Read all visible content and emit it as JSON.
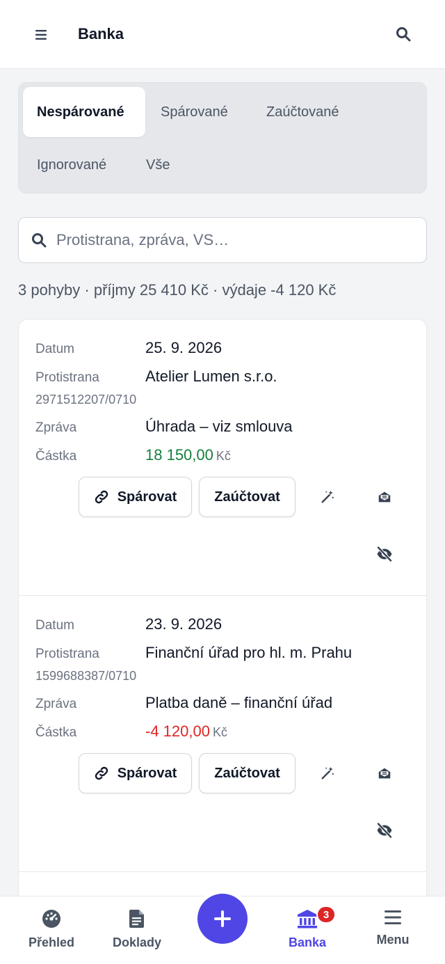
{
  "header": {
    "title": "Banka",
    "menu_icon": "hamburger-icon",
    "search_icon": "search-icon"
  },
  "tabs": [
    {
      "label": "Nespárované",
      "active": true
    },
    {
      "label": "Spárované",
      "active": false
    },
    {
      "label": "Zaúčtované",
      "active": false
    },
    {
      "label": "Ignorované",
      "active": false
    },
    {
      "label": "Vše",
      "active": false
    }
  ],
  "search": {
    "placeholder": "Protistrana, zpráva, VS…",
    "value": ""
  },
  "summary": "3 pohyby · příjmy 25 410 Kč · výdaje -4 120 Kč",
  "labels": {
    "date": "Datum",
    "counterparty": "Protistrana",
    "message": "Zpráva",
    "amount": "Částka"
  },
  "actions": {
    "match": "Spárovat",
    "post": "Zaúčtovat"
  },
  "transactions": [
    {
      "date": "25. 9. 2026",
      "counterparty": "Atelier Lumen s.r.o.",
      "account": "2971512207/0710",
      "message": "Úhrada – viz smlouva",
      "amount": "18 150,00",
      "currency": "Kč",
      "direction": "income"
    },
    {
      "date": "23. 9. 2026",
      "counterparty": "Finanční úřad pro hl. m. Prahu",
      "account": "1599688387/0710",
      "message": "Platba daně – finanční úřad",
      "amount": "-4 120,00",
      "currency": "Kč",
      "direction": "expense"
    }
  ],
  "bottom_nav": {
    "items": [
      {
        "label": "Přehled",
        "icon": "dashboard-icon"
      },
      {
        "label": "Doklady",
        "icon": "document-icon"
      },
      {
        "label": "Banka",
        "icon": "bank-icon",
        "active": true,
        "badge": "3"
      },
      {
        "label": "Menu",
        "icon": "hamburger-icon"
      }
    ],
    "fab_icon": "plus-icon"
  },
  "colors": {
    "accent": "#4f46e5",
    "income": "#15803d",
    "expense": "#dc2626",
    "badge": "#dc2626"
  }
}
